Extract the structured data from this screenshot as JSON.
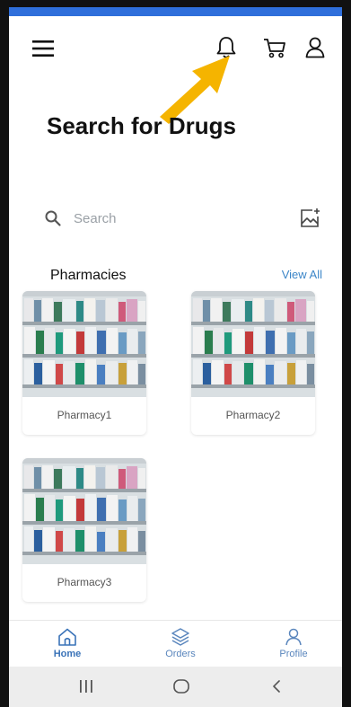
{
  "header": {
    "icons": [
      "menu-icon",
      "bell-icon",
      "cart-icon",
      "user-icon"
    ]
  },
  "page": {
    "title": "Search for Drugs"
  },
  "search": {
    "placeholder": "Search",
    "value": "",
    "icon": "search-icon",
    "image_search_icon": "image-search-icon"
  },
  "pharmacies": {
    "title": "Pharmacies",
    "view_all": "View All",
    "items": [
      {
        "name": "Pharmacy1"
      },
      {
        "name": "Pharmacy2"
      },
      {
        "name": "Pharmacy3"
      }
    ]
  },
  "bottom_nav": {
    "items": [
      {
        "label": "Home",
        "icon": "home-icon",
        "active": true
      },
      {
        "label": "Orders",
        "icon": "layers-icon",
        "active": false
      },
      {
        "label": "Profile",
        "icon": "profile-icon",
        "active": false
      }
    ]
  },
  "system_nav": [
    "recent-apps-icon",
    "home-circle-icon",
    "back-icon"
  ],
  "colors": {
    "accent": "#3c86c8",
    "status_strip": "#2f6fdb",
    "annotation_arrow": "#f5b400"
  }
}
